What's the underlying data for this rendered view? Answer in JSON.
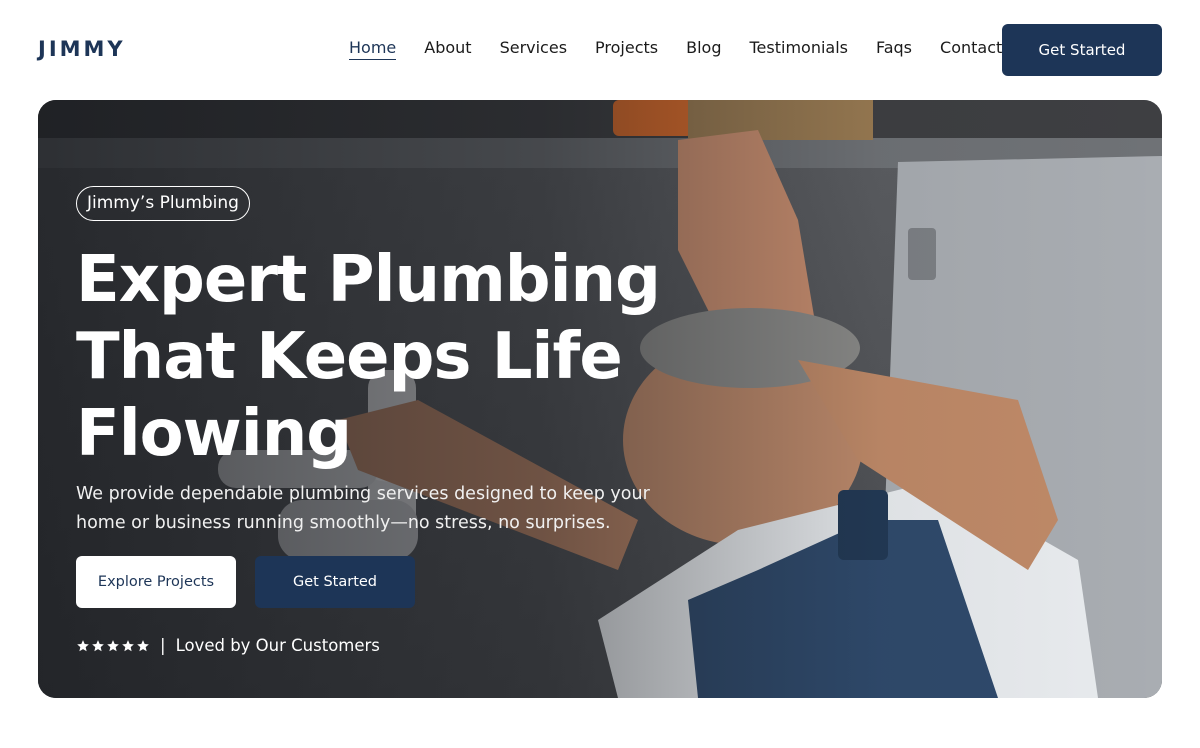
{
  "header": {
    "logo": "JIMMY",
    "nav": [
      "Home",
      "About",
      "Services",
      "Projects",
      "Blog",
      "Testimonials",
      "Faqs",
      "Contact"
    ],
    "active_nav": "Home",
    "cta_label": "Get Started"
  },
  "hero": {
    "badge": "Jimmy’s Plumbing",
    "title_lines": [
      "Expert Plumbing",
      "That Keeps Life",
      "Flowing"
    ],
    "subtitle": "We provide dependable plumbing services designed to keep your home or business running smoothly—no stress, no surprises.",
    "primary_button": "Explore Projects",
    "secondary_button": "Get Started",
    "rating_stars": 5,
    "rating_separator": "|",
    "rating_text": "Loved by Our Customers"
  },
  "colors": {
    "brand": "#1d3557",
    "white": "#ffffff"
  },
  "icons": {
    "star": "star-icon"
  }
}
